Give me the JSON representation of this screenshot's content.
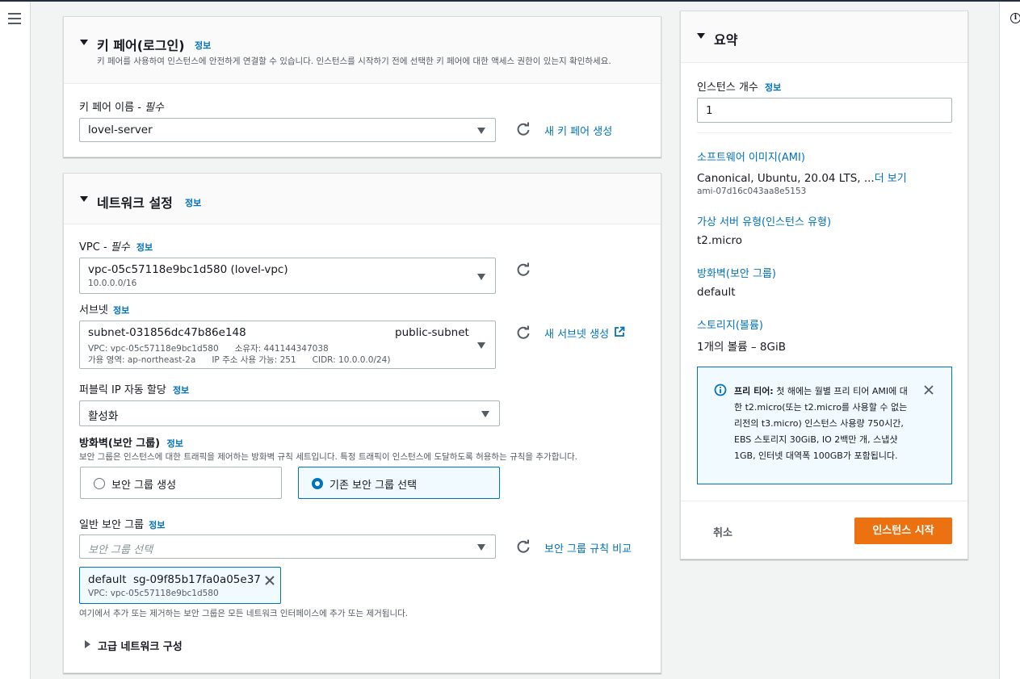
{
  "keypair": {
    "title": "키 페어(로그인)",
    "info": "정보",
    "description": "키 페어를 사용하여 인스턴스에 안전하게 연결할 수 있습니다. 인스턴스를 시작하기 전에 선택한 키 페어에 대한 액세스 권한이 있는지 확인하세요.",
    "name_label": "키 페어 이름 - ",
    "required": "필수",
    "selected": "lovel-server",
    "create_link": "새 키 페어 생성"
  },
  "network": {
    "title": "네트워크 설정",
    "info": "정보",
    "vpc_label": "VPC - ",
    "vpc_required": "필수",
    "vpc_info": "정보",
    "vpc_value": "vpc-05c57118e9bc1d580 (lovel-vpc)",
    "vpc_cidr": "10.0.0.0/16",
    "subnet_label": "서브넷",
    "subnet_info": "정보",
    "subnet_id": "subnet-031856dc47b86e148",
    "subnet_name": "public-subnet",
    "subnet_line2": "VPC: vpc-05c57118e9bc1d580      소유자: 441144347038",
    "subnet_line3": "가용 영역: ap-northeast-2a      IP 주소 사용 가능: 251      CIDR: 10.0.0.0/24)",
    "create_subnet_link": "새 서브넷 생성",
    "public_ip_label": "퍼블릭 IP 자동 할당",
    "public_ip_info": "정보",
    "public_ip_value": "활성화",
    "firewall_label": "방화벽(보안 그룹)",
    "firewall_info": "정보",
    "firewall_desc": "보안 그룹은 인스턴스에 대한 트래픽을 제어하는 방화벽 규칙 세트입니다. 특정 트래픽이 인스턴스에 도달하도록 허용하는 규칙을 추가합니다.",
    "option_create": "보안 그룹 생성",
    "option_existing": "기존 보안 그룹 선택",
    "sg_label": "일반 보안 그룹",
    "sg_info": "정보",
    "sg_placeholder": "보안 그룹 선택",
    "compare_link": "보안 그룹 규칙 비교",
    "token_name": "default",
    "token_id": "sg-09f85b17fa0a05e37",
    "token_vpc": "VPC: vpc-05c57118e9bc1d580",
    "sg_note": "여기에서 추가 또는 제거하는 보안 그룹은 모든 네트워크 인터페이스에 추가 또는 제거됩니다.",
    "advanced": "고급 네트워크 구성"
  },
  "summary": {
    "title": "요약",
    "count_label": "인스턴스 개수",
    "count_info": "정보",
    "count_value": "1",
    "ami_link": "소프트웨어 이미지(AMI)",
    "ami_value": "Canonical, Ubuntu, 20.04 LTS, ...",
    "ami_more": "더 보기",
    "ami_id": "ami-07d16c043aa8e5153",
    "type_link": "가상 서버 유형(인스턴스 유형)",
    "type_value": "t2.micro",
    "fw_link": "방화벽(보안 그룹)",
    "fw_value": "default",
    "storage_link": "스토리지(볼륨)",
    "storage_value": "1개의 볼륨 – 8GiB",
    "alert_bold": "프리 티어:",
    "alert_line1": " 첫 해에는 월별 프리 티어 AMI에 대",
    "alert_line2": "한 t2.micro(또는 t2.micro를 사용할 수 없는",
    "alert_line3": "리전의 t3.micro) 인스턴스 사용량 750시간,",
    "alert_line4": "EBS 스토리지 30GiB, IO 2백만 개, 스냅샷",
    "alert_line5": "1GB, 인터넷 대역폭 100GB가 포함됩니다.",
    "cancel": "취소",
    "launch": "인스턴스 시작"
  },
  "colors": {
    "accent": "#0073bb",
    "primary_button": "#ec7211",
    "header_bar": "#232f3e"
  }
}
